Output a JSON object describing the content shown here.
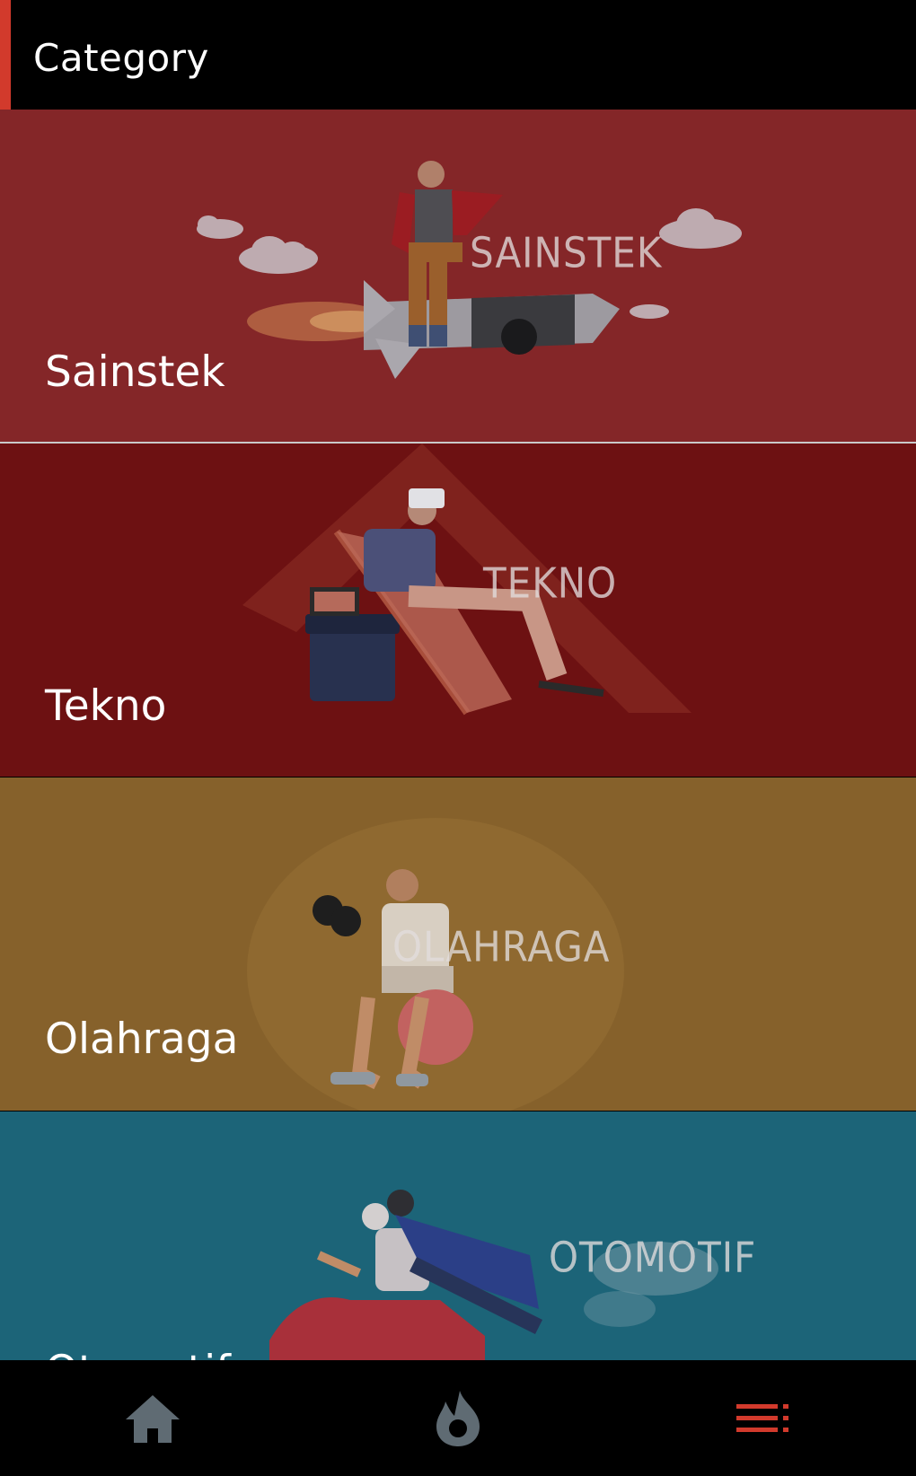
{
  "header": {
    "title": "Category"
  },
  "categories": [
    {
      "label": "Sainstek",
      "banner": "SAINSTEK",
      "bg": "#842628"
    },
    {
      "label": "Tekno",
      "banner": "TEKNO",
      "bg": "#6d1112"
    },
    {
      "label": "Olahraga",
      "banner": "OLAHRAGA",
      "bg": "#86612b"
    },
    {
      "label": "Otomotif",
      "banner": "OTOMOTIF",
      "bg": "#1c6478"
    }
  ],
  "nav": {
    "items": [
      {
        "icon": "home-icon",
        "color": "#5f6b73"
      },
      {
        "icon": "flame-icon",
        "color": "#5f6b73"
      },
      {
        "icon": "category-list-icon",
        "color": "#d23a2c",
        "active": true
      }
    ]
  }
}
